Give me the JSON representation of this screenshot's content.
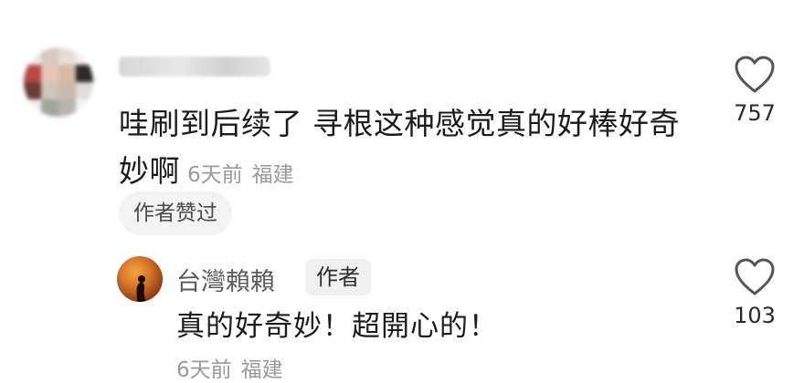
{
  "comment": {
    "avatar": "blurred-avatar",
    "username": "",
    "text": "哇刷到后续了 寻根这种感觉真的好棒好奇妙啊",
    "time": "6天前",
    "location": "福建",
    "author_liked_chip": "作者赞过",
    "likes": "757"
  },
  "reply": {
    "avatar": "sunset-avatar",
    "username": "台灣賴賴",
    "author_tag": "作者",
    "text": "真的好奇妙！超開心的！",
    "time": "6天前",
    "location": "福建",
    "likes": "103"
  },
  "icons": {
    "like": "heart-outline-icon"
  },
  "colors": {
    "text_primary": "#1b1b1b",
    "text_meta": "#9a9a9a",
    "chip_bg": "#f3f3f3",
    "icon_stroke": "#555555"
  }
}
